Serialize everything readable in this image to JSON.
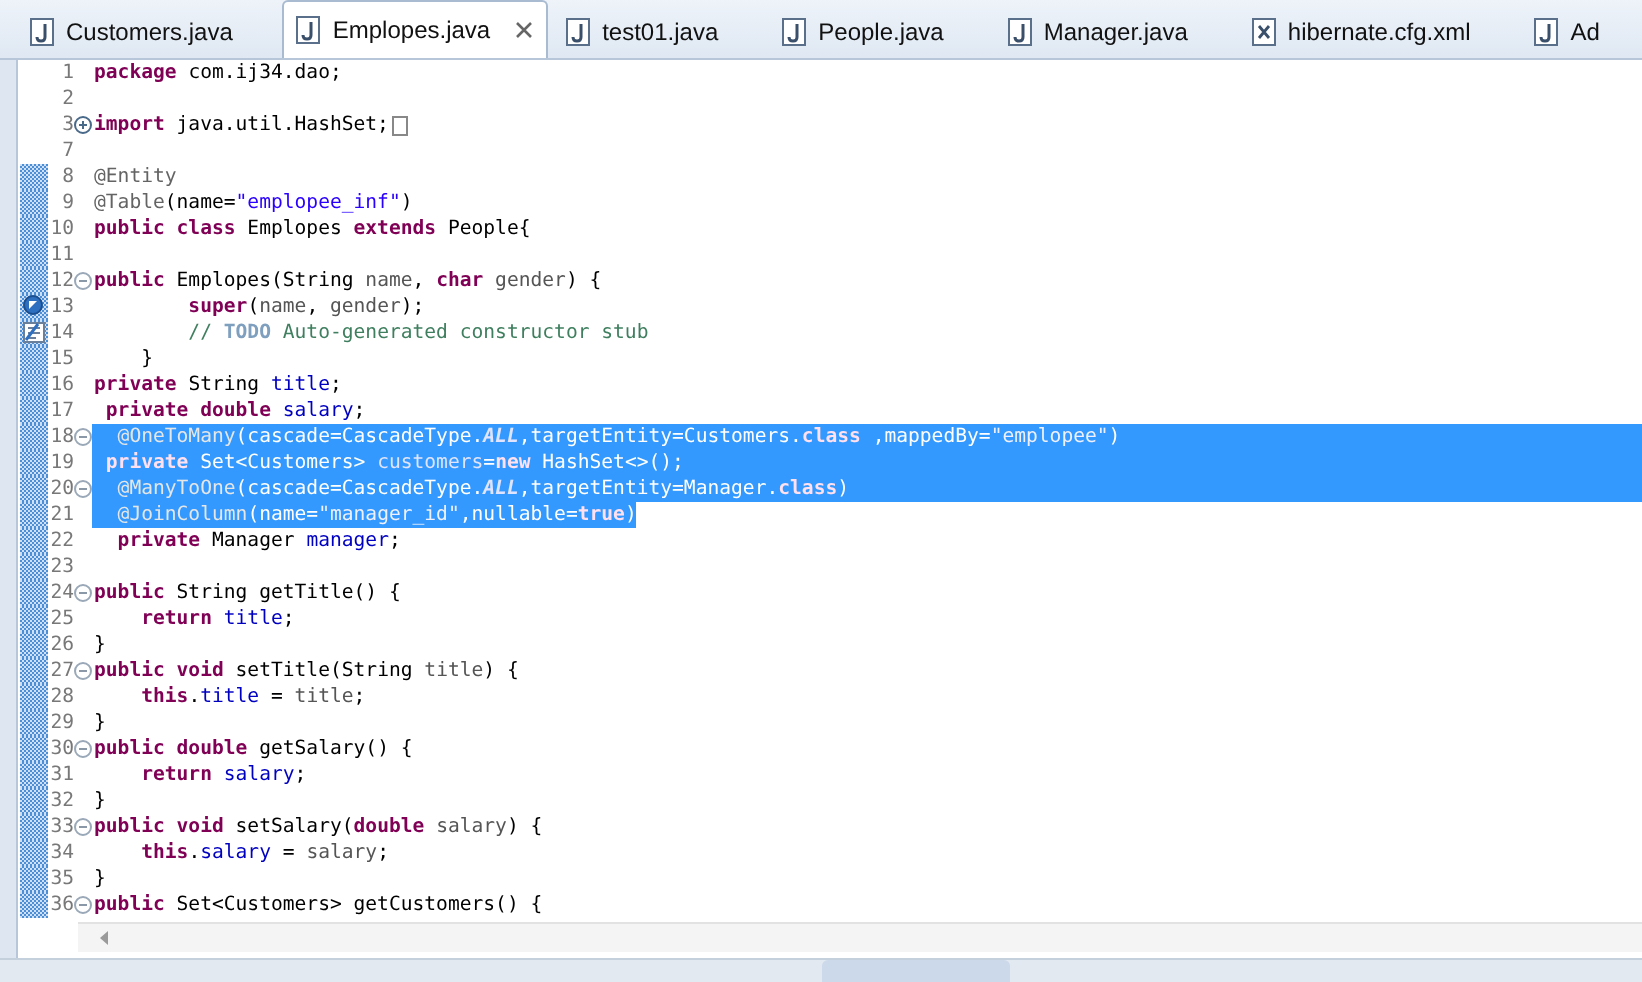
{
  "editor_tabs": [
    {
      "label": "Customers.java",
      "kind": "java",
      "selected": false,
      "closable": false
    },
    {
      "label": "Emplopes.java",
      "kind": "java",
      "selected": true,
      "closable": true
    },
    {
      "label": "test01.java",
      "kind": "java",
      "selected": false,
      "closable": false
    },
    {
      "label": "People.java",
      "kind": "java",
      "selected": false,
      "closable": false
    },
    {
      "label": "Manager.java",
      "kind": "java",
      "selected": false,
      "closable": false
    },
    {
      "label": "hibernate.cfg.xml",
      "kind": "xml",
      "selected": false,
      "closable": false
    },
    {
      "label": "Ad",
      "kind": "java",
      "selected": false,
      "closable": false
    }
  ],
  "editor": {
    "lines": [
      {
        "number": "1",
        "foldable": false,
        "changed": false,
        "selected": false,
        "tokens": [
          {
            "kind": "keyword",
            "text": "package"
          },
          {
            "kind": "plain",
            "text": " com.ij34.dao;"
          }
        ]
      },
      {
        "number": "2",
        "foldable": false,
        "changed": false,
        "selected": false
      },
      {
        "number": "3",
        "foldable": true,
        "folded": true,
        "changed": false,
        "selected": false,
        "tokens": [
          {
            "kind": "keyword",
            "text": "import"
          },
          {
            "kind": "plain",
            "text": " java.util.HashSet;"
          }
        ]
      },
      {
        "number": "7",
        "foldable": false,
        "changed": false,
        "selected": false
      },
      {
        "number": "8",
        "foldable": false,
        "changed": true,
        "selected": false,
        "tokens": [
          {
            "kind": "annotation",
            "text": "@Entity"
          }
        ]
      },
      {
        "number": "9",
        "foldable": false,
        "changed": true,
        "selected": false,
        "tokens": [
          {
            "kind": "annotation",
            "text": "@Table"
          },
          {
            "kind": "plain",
            "text": "(name="
          },
          {
            "kind": "string",
            "text": "\"emplopee_inf\""
          },
          {
            "kind": "plain",
            "text": ")"
          }
        ]
      },
      {
        "number": "10",
        "foldable": false,
        "changed": true,
        "selected": false,
        "tokens": [
          {
            "kind": "keyword",
            "text": "public"
          },
          {
            "kind": "keyword",
            "text": " class"
          },
          {
            "kind": "plain",
            "text": " Emplopes "
          },
          {
            "kind": "keyword",
            "text": "extends"
          },
          {
            "kind": "plain",
            "text": " People{"
          }
        ]
      },
      {
        "number": "11",
        "foldable": false,
        "changed": true,
        "selected": false
      },
      {
        "number": "12",
        "foldable": true,
        "folded": false,
        "changed": true,
        "selected": false,
        "tokens": [
          {
            "kind": "keyword",
            "text": "public"
          },
          {
            "kind": "plain",
            "text": " Emplopes(String "
          },
          {
            "kind": "parameter",
            "text": "name"
          },
          {
            "kind": "plain",
            "text": ", "
          },
          {
            "kind": "keyword",
            "text": "char"
          },
          {
            "kind": "parameter",
            "text": " gender"
          },
          {
            "kind": "plain",
            "text": ") {"
          }
        ]
      },
      {
        "number": "13",
        "foldable": false,
        "override_marker": true,
        "changed": true,
        "selected": false,
        "tokens": [
          {
            "kind": "keyword",
            "text": "        super"
          },
          {
            "kind": "plain",
            "text": "("
          },
          {
            "kind": "parameter",
            "text": "name"
          },
          {
            "kind": "plain",
            "text": ", "
          },
          {
            "kind": "parameter",
            "text": "gender"
          },
          {
            "kind": "plain",
            "text": ");"
          }
        ]
      },
      {
        "number": "14",
        "foldable": false,
        "task_marker": true,
        "changed": true,
        "selected": false,
        "tokens": [
          {
            "kind": "comment",
            "text": "        // "
          },
          {
            "kind": "todo",
            "text": "TODO"
          },
          {
            "kind": "comment",
            "text": " Auto-generated constructor stub"
          }
        ]
      },
      {
        "number": "15",
        "foldable": false,
        "changed": true,
        "selected": false,
        "tokens": [
          {
            "kind": "plain",
            "text": "    }"
          }
        ]
      },
      {
        "number": "16",
        "foldable": false,
        "changed": true,
        "selected": false,
        "tokens": [
          {
            "kind": "keyword",
            "text": "private"
          },
          {
            "kind": "plain",
            "text": " String "
          },
          {
            "kind": "field",
            "text": "title"
          },
          {
            "kind": "plain",
            "text": ";"
          }
        ]
      },
      {
        "number": "17",
        "foldable": false,
        "changed": true,
        "selected": false,
        "tokens": [
          {
            "kind": "keyword",
            "text": " private"
          },
          {
            "kind": "keyword",
            "text": " double"
          },
          {
            "kind": "field",
            "text": " salary"
          },
          {
            "kind": "plain",
            "text": ";"
          }
        ]
      },
      {
        "number": "18",
        "foldable": true,
        "folded": false,
        "changed": true,
        "selected": true,
        "tokens": [
          {
            "kind": "annotation",
            "text": "  @OneToMany"
          },
          {
            "kind": "plain",
            "text": "(cascade=CascadeType."
          },
          {
            "kind": "constant",
            "text": "ALL"
          },
          {
            "kind": "plain",
            "text": ",targetEntity=Customers."
          },
          {
            "kind": "keyword",
            "text": "class"
          },
          {
            "kind": "plain",
            "text": " ,mappedBy="
          },
          {
            "kind": "string",
            "text": "\"emplopee\""
          },
          {
            "kind": "plain",
            "text": ")"
          }
        ]
      },
      {
        "number": "19",
        "foldable": false,
        "changed": true,
        "selected": true,
        "tokens": [
          {
            "kind": "keyword",
            "text": " private"
          },
          {
            "kind": "plain",
            "text": " Set<Customers> "
          },
          {
            "kind": "field",
            "text": "customers"
          },
          {
            "kind": "plain",
            "text": "="
          },
          {
            "kind": "keyword",
            "text": "new"
          },
          {
            "kind": "plain",
            "text": " HashSet<>();"
          }
        ]
      },
      {
        "number": "20",
        "foldable": true,
        "folded": false,
        "changed": true,
        "selected": true,
        "tokens": [
          {
            "kind": "annotation",
            "text": "  @ManyToOne"
          },
          {
            "kind": "plain",
            "text": "(cascade=CascadeType."
          },
          {
            "kind": "constant",
            "text": "ALL"
          },
          {
            "kind": "plain",
            "text": ",targetEntity=Manager."
          },
          {
            "kind": "keyword",
            "text": "class"
          },
          {
            "kind": "plain",
            "text": ")"
          }
        ]
      },
      {
        "number": "21",
        "foldable": false,
        "changed": true,
        "selected": true,
        "tokens": [
          {
            "kind": "annotation",
            "text": "  @JoinColumn"
          },
          {
            "kind": "plain",
            "text": "(name="
          },
          {
            "kind": "string",
            "text": "\"manager_id\""
          },
          {
            "kind": "plain",
            "text": ",nullable="
          },
          {
            "kind": "keyword",
            "text": "true"
          },
          {
            "kind": "plain",
            "text": ")"
          }
        ]
      },
      {
        "number": "22",
        "foldable": false,
        "changed": true,
        "selected": false,
        "tokens": [
          {
            "kind": "keyword",
            "text": "  private"
          },
          {
            "kind": "plain",
            "text": " Manager "
          },
          {
            "kind": "field",
            "text": "manager"
          },
          {
            "kind": "plain",
            "text": ";"
          }
        ]
      },
      {
        "number": "23",
        "foldable": false,
        "changed": true,
        "selected": false
      },
      {
        "number": "24",
        "foldable": true,
        "folded": false,
        "changed": true,
        "selected": false,
        "tokens": [
          {
            "kind": "keyword",
            "text": "public"
          },
          {
            "kind": "plain",
            "text": " String getTitle() {"
          }
        ]
      },
      {
        "number": "25",
        "foldable": false,
        "changed": true,
        "selected": false,
        "tokens": [
          {
            "kind": "keyword",
            "text": "    return"
          },
          {
            "kind": "field",
            "text": " title"
          },
          {
            "kind": "plain",
            "text": ";"
          }
        ]
      },
      {
        "number": "26",
        "foldable": false,
        "changed": true,
        "selected": false,
        "tokens": [
          {
            "kind": "plain",
            "text": "}"
          }
        ]
      },
      {
        "number": "27",
        "foldable": true,
        "folded": false,
        "changed": true,
        "selected": false,
        "tokens": [
          {
            "kind": "keyword",
            "text": "public"
          },
          {
            "kind": "keyword",
            "text": " void"
          },
          {
            "kind": "plain",
            "text": " setTitle(String "
          },
          {
            "kind": "parameter",
            "text": "title"
          },
          {
            "kind": "plain",
            "text": ") {"
          }
        ]
      },
      {
        "number": "28",
        "foldable": false,
        "changed": true,
        "selected": false,
        "tokens": [
          {
            "kind": "keyword",
            "text": "    this"
          },
          {
            "kind": "plain",
            "text": "."
          },
          {
            "kind": "field",
            "text": "title"
          },
          {
            "kind": "plain",
            "text": " = "
          },
          {
            "kind": "parameter",
            "text": "title"
          },
          {
            "kind": "plain",
            "text": ";"
          }
        ]
      },
      {
        "number": "29",
        "foldable": false,
        "changed": true,
        "selected": false,
        "tokens": [
          {
            "kind": "plain",
            "text": "}"
          }
        ]
      },
      {
        "number": "30",
        "foldable": true,
        "folded": false,
        "changed": true,
        "selected": false,
        "tokens": [
          {
            "kind": "keyword",
            "text": "public"
          },
          {
            "kind": "keyword",
            "text": " double"
          },
          {
            "kind": "plain",
            "text": " getSalary() {"
          }
        ]
      },
      {
        "number": "31",
        "foldable": false,
        "changed": true,
        "selected": false,
        "tokens": [
          {
            "kind": "keyword",
            "text": "    return"
          },
          {
            "kind": "field",
            "text": " salary"
          },
          {
            "kind": "plain",
            "text": ";"
          }
        ]
      },
      {
        "number": "32",
        "foldable": false,
        "changed": true,
        "selected": false,
        "tokens": [
          {
            "kind": "plain",
            "text": "}"
          }
        ]
      },
      {
        "number": "33",
        "foldable": true,
        "folded": false,
        "changed": true,
        "selected": false,
        "tokens": [
          {
            "kind": "keyword",
            "text": "public"
          },
          {
            "kind": "keyword",
            "text": " void"
          },
          {
            "kind": "plain",
            "text": " setSalary("
          },
          {
            "kind": "keyword",
            "text": "double"
          },
          {
            "kind": "parameter",
            "text": " salary"
          },
          {
            "kind": "plain",
            "text": ") {"
          }
        ]
      },
      {
        "number": "34",
        "foldable": false,
        "changed": true,
        "selected": false,
        "tokens": [
          {
            "kind": "keyword",
            "text": "    this"
          },
          {
            "kind": "plain",
            "text": "."
          },
          {
            "kind": "field",
            "text": "salary"
          },
          {
            "kind": "plain",
            "text": " = "
          },
          {
            "kind": "parameter",
            "text": "salary"
          },
          {
            "kind": "plain",
            "text": ";"
          }
        ]
      },
      {
        "number": "35",
        "foldable": false,
        "changed": true,
        "selected": false,
        "tokens": [
          {
            "kind": "plain",
            "text": "}"
          }
        ]
      },
      {
        "number": "36",
        "foldable": true,
        "folded": false,
        "changed": true,
        "selected": false,
        "tokens": [
          {
            "kind": "keyword",
            "text": "public"
          },
          {
            "kind": "plain",
            "text": " Set<Customers> getCustomers() {"
          }
        ]
      }
    ]
  }
}
